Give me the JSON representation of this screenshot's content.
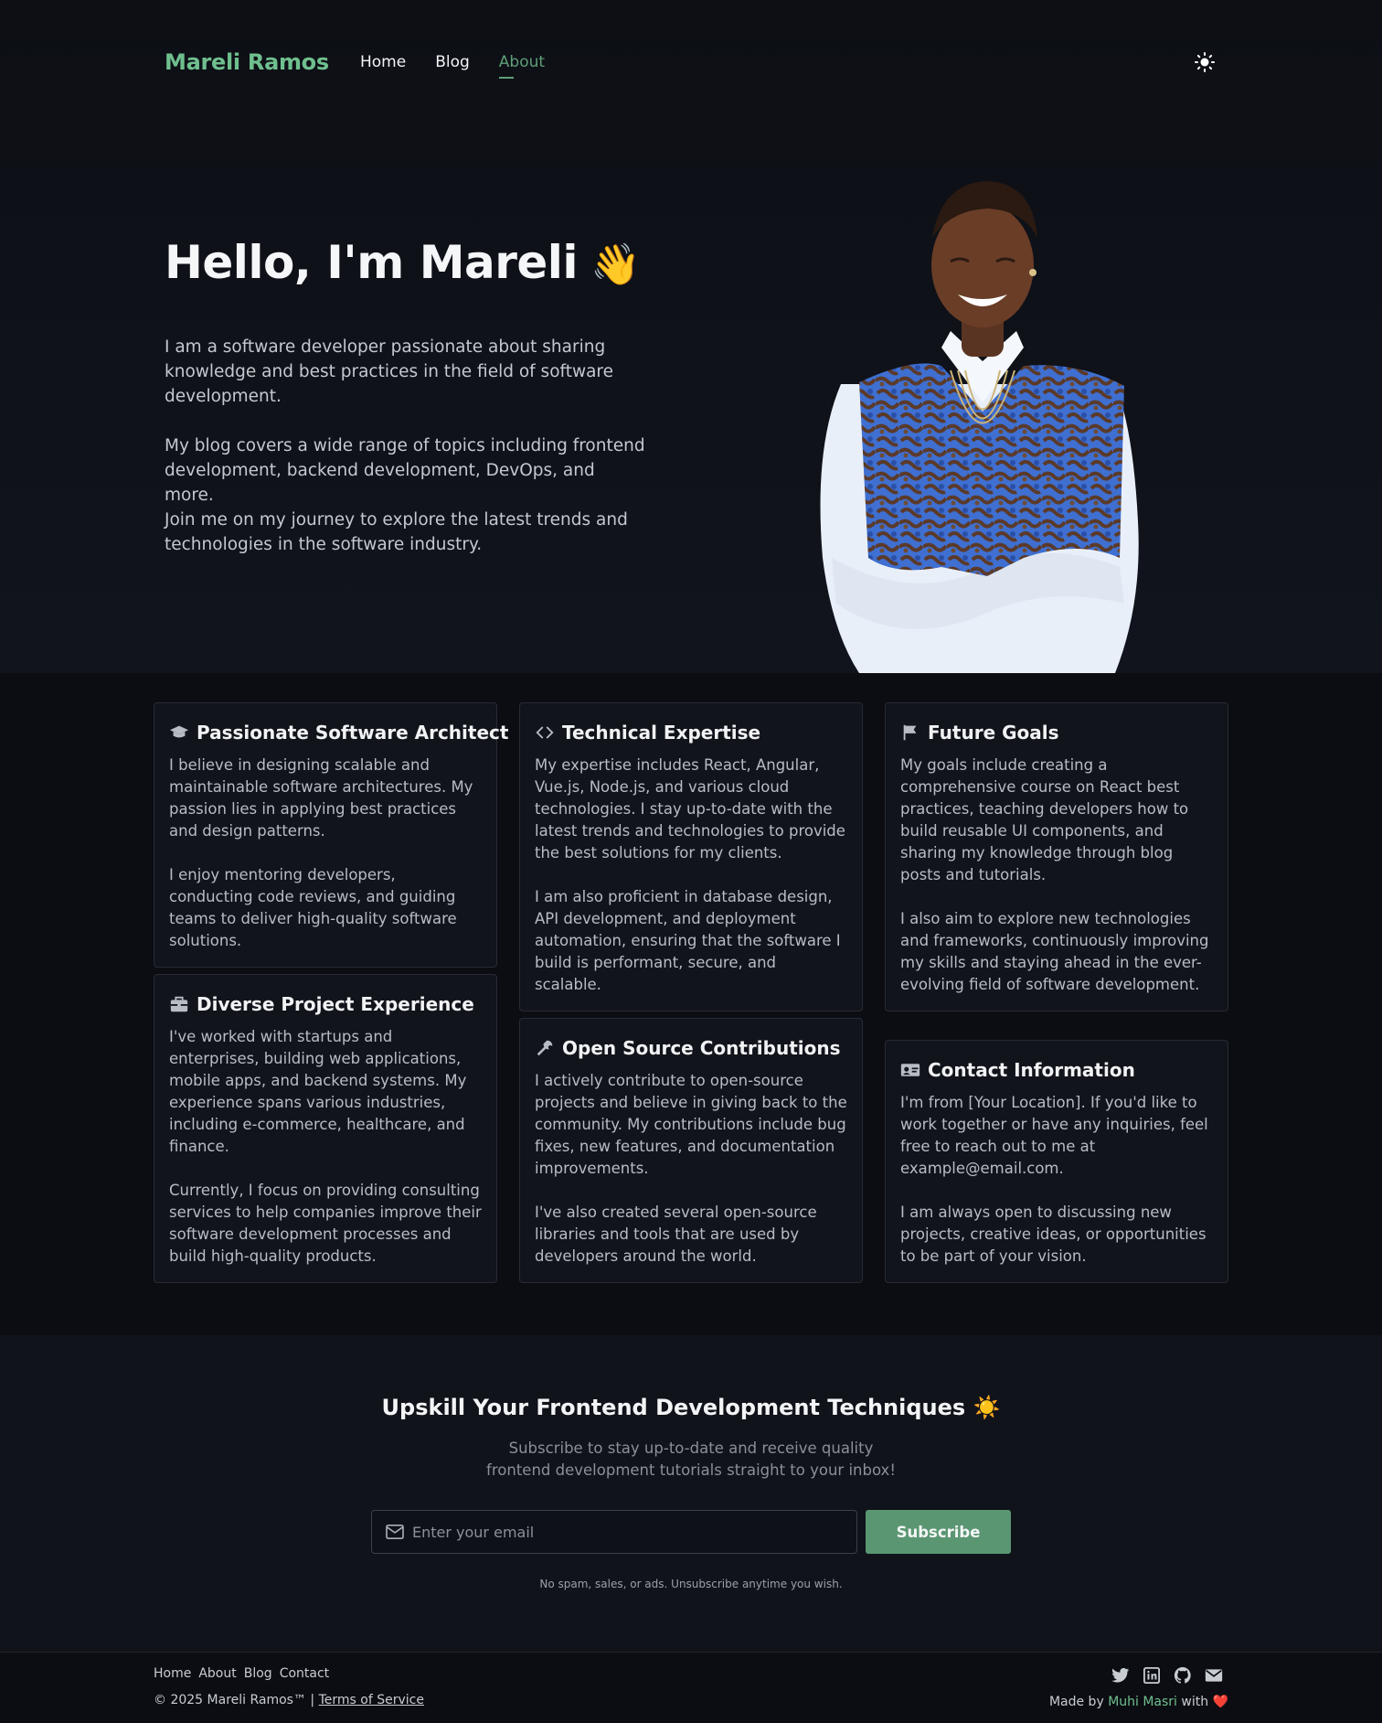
{
  "nav": {
    "brand": "Mareli Ramos",
    "links": [
      "Home",
      "Blog",
      "About"
    ],
    "active": "About"
  },
  "hero": {
    "title": "Hello, I'm Mareli",
    "wave": "👋",
    "paragraphs": [
      "I am a software developer passionate about sharing knowledge and best practices in the field of software development.",
      "My blog covers a wide range of topics including frontend development, backend development, DevOps, and more.",
      "Join me on my journey to explore the latest trends and technologies in the software industry."
    ]
  },
  "cards": [
    {
      "icon": "graduation-cap-icon",
      "title": "Passionate Software Architect",
      "paragraphs": [
        "I believe in designing scalable and maintainable software architectures. My passion lies in applying best practices and design patterns.",
        "I enjoy mentoring developers, conducting code reviews, and guiding teams to deliver high-quality software solutions."
      ]
    },
    {
      "icon": "code-icon",
      "title": "Technical Expertise",
      "paragraphs": [
        "My expertise includes React, Angular, Vue.js, Node.js, and various cloud technologies. I stay up-to-date with the latest trends and technologies to provide the best solutions for my clients.",
        "I am also proficient in database design, API development, and deployment automation, ensuring that the software I build is performant, secure, and scalable."
      ]
    },
    {
      "icon": "flag-icon",
      "title": "Future Goals",
      "paragraphs": [
        "My goals include creating a comprehensive course on React best practices, teaching developers how to build reusable UI components, and sharing my knowledge through blog posts and tutorials.",
        "I also aim to explore new technologies and frameworks, continuously improving my skills and staying ahead in the ever-evolving field of software development."
      ]
    },
    {
      "icon": "briefcase-icon",
      "title": "Diverse Project Experience",
      "paragraphs": [
        "I've worked with startups and enterprises, building web applications, mobile apps, and backend systems. My experience spans various industries, including e-commerce, healthcare, and finance.",
        "Currently, I focus on providing consulting services to help companies improve their software development processes and build high-quality products."
      ]
    },
    {
      "icon": "wrench-icon",
      "title": "Open Source Contributions",
      "paragraphs": [
        "I actively contribute to open-source projects and believe in giving back to the community. My contributions include bug fixes, new features, and documentation improvements.",
        "I've also created several open-source libraries and tools that are used by developers around the world."
      ]
    },
    {
      "icon": "id-card-icon",
      "title": "Contact Information",
      "paragraphs": [
        "I'm from [Your Location]. If you'd like to work together or have any inquiries, feel free to reach out to me at example@email.com.",
        "I am always open to discussing new projects, creative ideas, or opportunities to be part of your vision."
      ]
    }
  ],
  "newsletter": {
    "title": "Upskill Your Frontend Development Techniques",
    "title_icon": "☀️",
    "subtitle_line1": "Subscribe to stay up-to-date and receive quality",
    "subtitle_line2": "frontend development tutorials straight to your inbox!",
    "placeholder": "Enter your email",
    "button": "Subscribe",
    "note": "No spam, sales, or ads. Unsubscribe anytime you wish."
  },
  "footer": {
    "links": [
      "Home",
      "About",
      "Blog",
      "Contact"
    ],
    "copyright": "© 2025 Mareli Ramos™ |",
    "terms": "Terms of Service",
    "made_by_prefix": "Made by",
    "author": "Muhi Masri",
    "made_by_suffix": "with",
    "heart": "❤️",
    "socials": [
      "twitter-icon",
      "linkedin-icon",
      "github-icon",
      "mail-icon"
    ]
  },
  "colors": {
    "accent": "#6fbf8e",
    "button": "#5a9672",
    "background": "#0b0d12",
    "card": "#11141b"
  }
}
